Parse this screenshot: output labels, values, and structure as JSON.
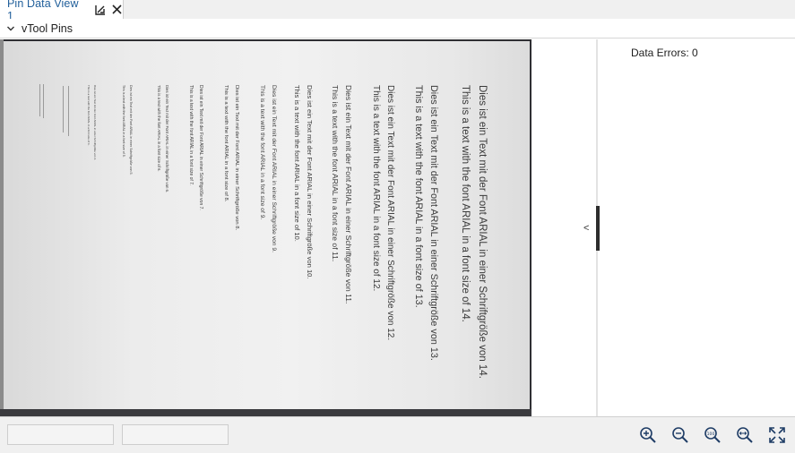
{
  "tab": {
    "title": "Pin Data View 1",
    "icons": [
      "chart-toggle-icon",
      "close-icon"
    ]
  },
  "section": {
    "title": "vTool Pins"
  },
  "side": {
    "errors_label": "Data Errors: 0"
  },
  "splitter": {
    "collapse_left": "<",
    "collapse_right": ">"
  },
  "document": {
    "lines": [
      "Dies ist ein Text mit der Font ARIAL in einer Schriftgröße von 14.",
      "This is a text with the font ARIAL in a font size of 14.",
      "Dies ist ein Text mit der Font ARIAL in einer Schriftgröße von 13.",
      "This is a text with the font ARIAL in a font size of 13.",
      "Dies ist ein Text mit der Font ARIAL in einer Schriftgröße von 12.",
      "This is a text with the font ARIAL in a font size of 12.",
      "Dies ist ein Text mit der Font ARIAL in einer Schriftgröße von 11.",
      "This is a text with the font ARIAL in a font size of 11.",
      "Dies ist ein Text mit der Font ARIAL in einer Schriftgröße von 10.",
      "This is a text with the font ARIAL in a font size of 10.",
      "Dies ist ein Text mit der Font ARIAL in einer Schriftgröße von 9.",
      "This is a text with the font ARIAL in a font size of 9.",
      "Dies ist ein Text mit der Font ARIAL in einer Schriftgröße von 8.",
      "This is a text with the font ARIAL in a font size of 8.",
      "Dies ist ein Text mit der Font ARIAL in einer Schriftgröße von 7.",
      "This is a text with the font ARIAL in a font size of 7.",
      "Dies ist ein Text mit der Font ARIAL in einer Schriftgröße von 6.",
      "This is a text with the font ARIAL in a font size of 6.",
      "Dies ist ein Text mit der Font ARIAL in einer Schriftgröße von 5.",
      "This is a text with the font ARIAL in a font size of 5.",
      "Dies ist ein Text mit der Font ARIAL in einer Schriftgröße von 4.",
      "This is a text with the font ARIAL in a font size of 4."
    ]
  },
  "status": {
    "field1": "",
    "field2": ""
  },
  "zoom": {
    "buttons": [
      "zoom-in-icon",
      "zoom-out-icon",
      "zoom-100-icon",
      "zoom-fit-width-icon",
      "fit-to-window-icon"
    ],
    "zoom100_label": "100"
  },
  "colors": {
    "tab_title": "#1f5e9a",
    "accent": "#1f5e9a"
  }
}
